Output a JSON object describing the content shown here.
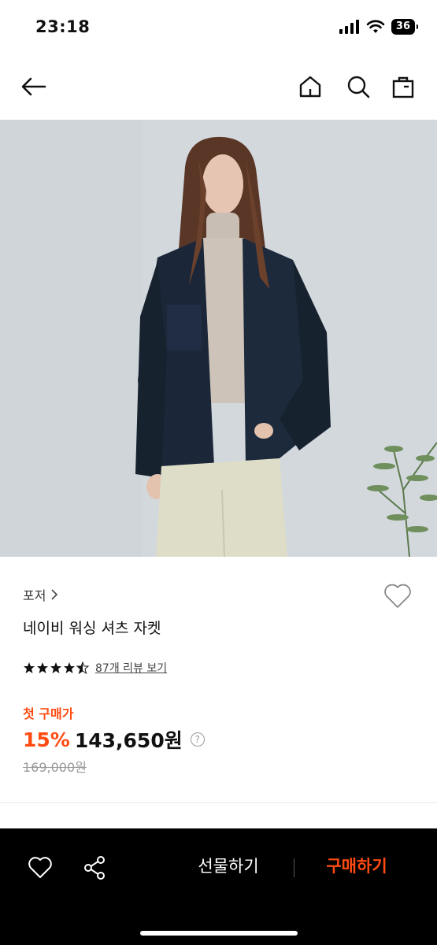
{
  "status": {
    "time": "23:18",
    "battery": "36"
  },
  "nav": {
    "back_icon": "arrow-left-icon",
    "home_icon": "home-icon",
    "search_icon": "search-icon",
    "cart_icon": "shopping-bag-icon"
  },
  "product": {
    "brand": "포저",
    "name": "네이비 워싱 셔츠 자켓",
    "rating": 4.5,
    "review_link": "87개 리뷰 보기",
    "first_purchase_label": "첫 구매가",
    "discount": "15%",
    "price": "143,650원",
    "help_symbol": "?",
    "original_price": "169,000원"
  },
  "bottom_bar": {
    "wish_icon": "heart-icon",
    "share_icon": "share-icon",
    "gift_label": "선물하기",
    "buy_label": "구매하기"
  },
  "colors": {
    "accent": "#ff4b12",
    "bar_bg": "#000000"
  }
}
